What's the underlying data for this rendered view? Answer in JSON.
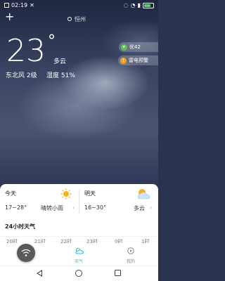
{
  "status_bar": {
    "time": "02:19",
    "battery_level": 0.78
  },
  "location": {
    "name": "恒州"
  },
  "current": {
    "temperature": "23",
    "unit": "°",
    "condition": "多云",
    "wind": "东北风 2级",
    "humidity_label": "湿度",
    "humidity_value": "51%"
  },
  "badges": {
    "aqi": {
      "icon_text": "AQI",
      "label": "优42",
      "color": "#5cc34c"
    },
    "warning": {
      "icon_text": "!",
      "label": "雷电预警",
      "color": "#f0a21c"
    }
  },
  "forecast": {
    "today": {
      "label": "今天",
      "range": "17~28°",
      "desc": "晴转小雨",
      "icon": "sun-icon"
    },
    "tomorrow": {
      "label": "明天",
      "range": "16~30°",
      "desc": "多云",
      "icon": "cloud-sun-icon"
    }
  },
  "hourly": {
    "title": "24小时天气",
    "hours": [
      "20时",
      "21时",
      "22时",
      "23时",
      "0时",
      "1时"
    ]
  },
  "tabs": [
    {
      "label": "天气",
      "icon": "weather-icon",
      "active": true
    },
    {
      "label": "我的",
      "icon": "profile-icon",
      "active": false
    }
  ],
  "colors": {
    "accent": "#2fb8d6",
    "sun": "#f5b21b"
  }
}
